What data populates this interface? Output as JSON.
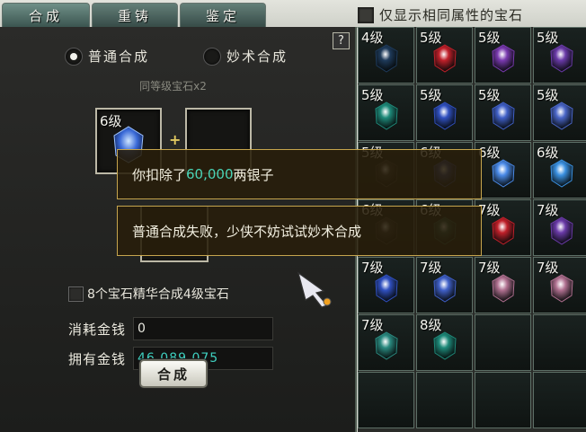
{
  "tabs": [
    {
      "label": "合成",
      "active": true
    },
    {
      "label": "重铸",
      "active": false
    },
    {
      "label": "鉴定",
      "active": false
    }
  ],
  "filter": {
    "label": "仅显示相同属性的宝石",
    "checked": false
  },
  "help": "?",
  "mode": {
    "normal": "普通合成",
    "magic": "妙术合成",
    "selected": "normal"
  },
  "hint": "同等级宝石x2",
  "slot1": {
    "level": "6级"
  },
  "essence_option": {
    "label": "8个宝石精华合成4级宝石",
    "checked": false
  },
  "cost": {
    "label": "消耗金钱",
    "value": "0"
  },
  "owned": {
    "label": "拥有金钱",
    "value": "46,089,075"
  },
  "compose_button": "合成",
  "toast1": {
    "prefix": "你扣除了",
    "amount": "60,000",
    "suffix": "两银子"
  },
  "toast2": {
    "text": "普通合成失败，少侠不妨试试妙术合成"
  },
  "gems": [
    {
      "level": "4级",
      "color": "#1e3a5a"
    },
    {
      "level": "5级",
      "color": "#c0202a"
    },
    {
      "level": "5级",
      "color": "#7a3ab0"
    },
    {
      "level": "5级",
      "color": "#6a3aa8"
    },
    {
      "level": "5级",
      "color": "#1e8a7a"
    },
    {
      "level": "5级",
      "color": "#3050c0"
    },
    {
      "level": "5级",
      "color": "#4060c8"
    },
    {
      "level": "5级",
      "color": "#4a66c8"
    },
    {
      "level": "5级",
      "color": "#3a3a3a"
    },
    {
      "level": "6级",
      "color": "#3a4aa0"
    },
    {
      "level": "6级",
      "color": "#4a8ae8"
    },
    {
      "level": "6级",
      "color": "#3a90e0"
    },
    {
      "level": "6级",
      "color": "#3a3a3a"
    },
    {
      "level": "6级",
      "color": "#2a5a50"
    },
    {
      "level": "7级",
      "color": "#c0202a"
    },
    {
      "level": "7级",
      "color": "#6a3aa8"
    },
    {
      "level": "7级",
      "color": "#3050c0"
    },
    {
      "level": "7级",
      "color": "#4060c8"
    },
    {
      "level": "7级",
      "color": "#b07090"
    },
    {
      "level": "7级",
      "color": "#b07090"
    },
    {
      "level": "7级",
      "color": "#2a8a80"
    },
    {
      "level": "8级",
      "color": "#1e8a7a"
    },
    {
      "level": "",
      "color": ""
    },
    {
      "level": "",
      "color": ""
    },
    {
      "level": "",
      "color": ""
    },
    {
      "level": "",
      "color": ""
    },
    {
      "level": "",
      "color": ""
    },
    {
      "level": "",
      "color": ""
    }
  ]
}
